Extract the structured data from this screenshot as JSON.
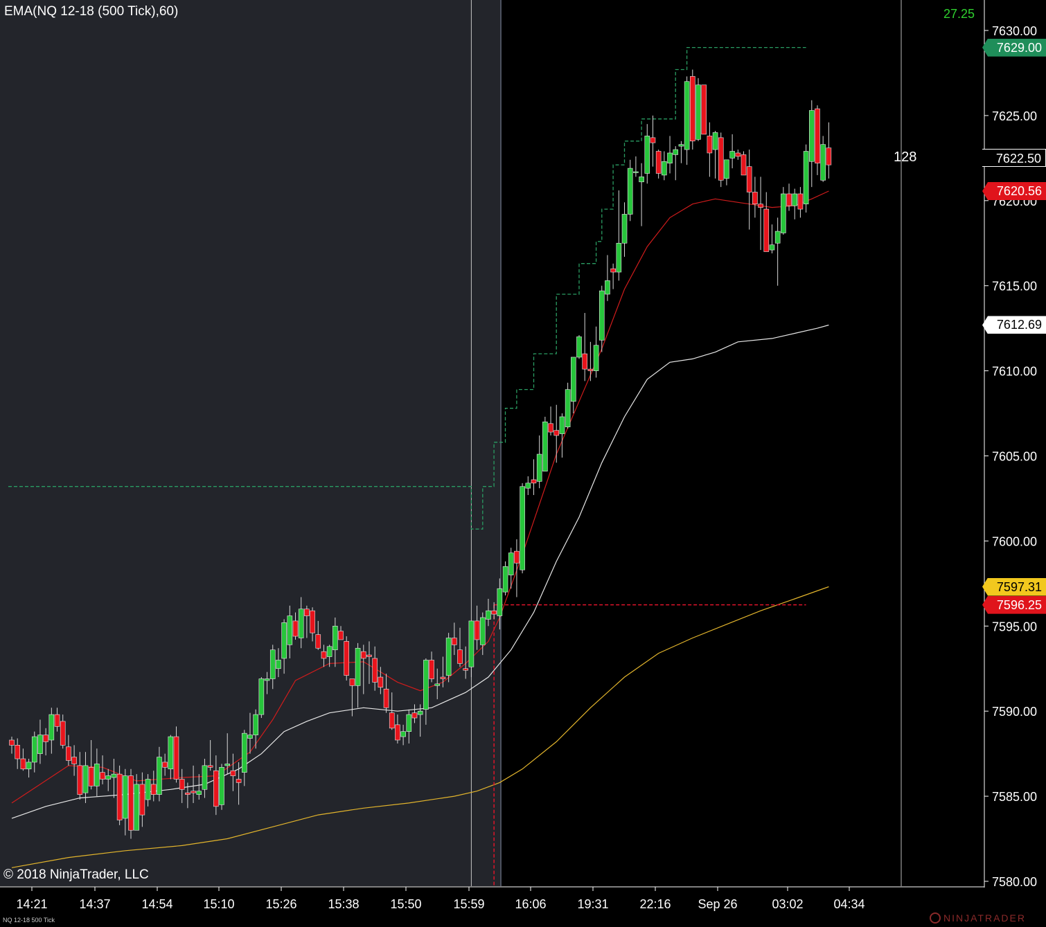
{
  "header": {
    "indicator_title": "EMA(NQ 12-18 (500 Tick),60)",
    "top_value": "27.25",
    "tick_count": "128",
    "copyright": "© 2018 NinjaTrader, LLC",
    "instrument_footer": "NQ 12-18 500 Tick",
    "logo_text": "NINJATRADER"
  },
  "colors": {
    "background_session": "#000000",
    "background_offsession": "#23252b",
    "up_candle": "#27c53b",
    "down_candle": "#e8141c",
    "ema_fast": "#d01c1c",
    "ema_mid": "#e8e8e8",
    "ema_slow": "#e3b52c",
    "high_level": "#2a9d63",
    "low_level": "#e0142a",
    "axis_text": "#ffffff"
  },
  "price_markers": [
    {
      "label": "7629.00",
      "price": 7629.0,
      "bg": "#1f8e5a",
      "fg": "#ffffff"
    },
    {
      "label": "7622.50",
      "price": 7622.5,
      "bg": "#000000",
      "fg": "#ffffff"
    },
    {
      "label": "7620.56",
      "price": 7620.56,
      "bg": "#e0141c",
      "fg": "#ffffff"
    },
    {
      "label": "7612.69",
      "price": 7612.69,
      "bg": "#ffffff",
      "fg": "#000000"
    },
    {
      "label": "7597.31",
      "price": 7597.31,
      "bg": "#f2c81e",
      "fg": "#000000"
    },
    {
      "label": "7596.25",
      "price": 7596.25,
      "bg": "#e0141c",
      "fg": "#ffffff"
    }
  ],
  "chart_data": {
    "type": "candlestick",
    "ylim": [
      7579.9,
      7630.3
    ],
    "y_ticks": [
      "7630.00",
      "7625.00",
      "7620.00",
      "7615.00",
      "7610.00",
      "7605.00",
      "7600.00",
      "7595.00",
      "7590.00",
      "7585.00",
      "7580.00"
    ],
    "x_labels": [
      "14:21",
      "14:37",
      "14:54",
      "15:10",
      "15:26",
      "15:38",
      "15:50",
      "15:59",
      "16:06",
      "19:31",
      "22:16",
      "Sep 26",
      "03:02",
      "04:34"
    ],
    "offsession_bar_range": [
      0,
      73
    ],
    "session_line_bar": 81,
    "candles": [
      [
        7588.3,
        7588.5,
        7587.5,
        7588.0
      ],
      [
        7588.0,
        7588.4,
        7586.6,
        7587.2
      ],
      [
        7587.2,
        7587.8,
        7586.5,
        7586.6
      ],
      [
        7586.6,
        7587.2,
        7586.1,
        7587.0
      ],
      [
        7587.0,
        7588.8,
        7586.4,
        7588.5
      ],
      [
        7587.5,
        7589.5,
        7586.9,
        7588.6
      ],
      [
        7588.6,
        7589.0,
        7587.4,
        7588.2
      ],
      [
        7588.3,
        7590.2,
        7587.5,
        7589.8
      ],
      [
        7589.8,
        7590.2,
        7588.8,
        7589.1
      ],
      [
        7589.4,
        7589.8,
        7587.8,
        7588.0
      ],
      [
        7587.9,
        7588.6,
        7586.8,
        7587.1
      ],
      [
        7587.3,
        7588.0,
        7586.2,
        7586.9
      ],
      [
        7586.8,
        7587.6,
        7584.8,
        7585.1
      ],
      [
        7585.2,
        7587.6,
        7584.6,
        7586.8
      ],
      [
        7586.7,
        7588.3,
        7585.4,
        7585.6
      ],
      [
        7585.6,
        7587.8,
        7585.0,
        7586.9
      ],
      [
        7586.4,
        7587.4,
        7585.7,
        7586.0
      ],
      [
        7586.0,
        7586.6,
        7585.3,
        7586.2
      ],
      [
        7586.1,
        7587.2,
        7584.9,
        7586.3
      ],
      [
        7586.3,
        7586.8,
        7583.3,
        7583.6
      ],
      [
        7583.7,
        7586.6,
        7582.7,
        7586.2
      ],
      [
        7586.2,
        7586.6,
        7582.5,
        7583.0
      ],
      [
        7583.0,
        7586.3,
        7583.0,
        7585.7
      ],
      [
        7585.7,
        7586.4,
        7583.2,
        7583.9
      ],
      [
        7584.8,
        7586.3,
        7584.4,
        7586.0
      ],
      [
        7585.7,
        7586.5,
        7584.7,
        7585.1
      ],
      [
        7585.1,
        7587.9,
        7584.7,
        7587.3
      ],
      [
        7587.0,
        7587.5,
        7586.2,
        7586.7
      ],
      [
        7586.6,
        7588.6,
        7586.0,
        7588.5
      ],
      [
        7588.5,
        7589.1,
        7585.8,
        7586.0
      ],
      [
        7586.0,
        7586.6,
        7584.6,
        7585.4
      ],
      [
        7585.2,
        7585.8,
        7584.3,
        7585.1
      ],
      [
        7585.3,
        7586.8,
        7584.6,
        7585.2
      ],
      [
        7585.1,
        7586.3,
        7584.8,
        7585.3
      ],
      [
        7585.4,
        7587.2,
        7584.9,
        7586.8
      ],
      [
        7586.8,
        7588.3,
        7586.5,
        7586.7
      ],
      [
        7586.5,
        7587.4,
        7583.9,
        7584.4
      ],
      [
        7584.5,
        7586.9,
        7584.2,
        7586.7
      ],
      [
        7586.8,
        7588.7,
        7586.3,
        7586.9
      ],
      [
        7586.5,
        7587.5,
        7585.3,
        7586.2
      ],
      [
        7586.0,
        7587.0,
        7584.5,
        7585.8
      ],
      [
        7586.4,
        7588.9,
        7585.6,
        7588.7
      ],
      [
        7588.4,
        7589.9,
        7587.5,
        7588.6
      ],
      [
        7588.6,
        7590.1,
        7587.8,
        7589.8
      ],
      [
        7589.8,
        7592.0,
        7589.6,
        7591.9
      ],
      [
        7591.8,
        7592.3,
        7591.0,
        7591.9
      ],
      [
        7591.9,
        7593.9,
        7591.3,
        7593.6
      ],
      [
        7592.5,
        7593.7,
        7592.0,
        7593.0
      ],
      [
        7593.1,
        7595.4,
        7592.2,
        7595.2
      ],
      [
        7593.9,
        7596.2,
        7593.1,
        7595.6
      ],
      [
        7595.3,
        7595.8,
        7594.2,
        7594.4
      ],
      [
        7594.3,
        7596.7,
        7593.7,
        7596.0
      ],
      [
        7596.0,
        7596.2,
        7594.3,
        7595.6
      ],
      [
        7595.9,
        7596.1,
        7594.1,
        7594.6
      ],
      [
        7594.5,
        7595.3,
        7593.6,
        7593.7
      ],
      [
        7593.5,
        7593.9,
        7592.6,
        7593.1
      ],
      [
        7593.2,
        7593.9,
        7592.6,
        7593.8
      ],
      [
        7593.6,
        7595.5,
        7592.6,
        7595.0
      ],
      [
        7594.7,
        7595.0,
        7594.3,
        7594.2
      ],
      [
        7594.1,
        7594.4,
        7591.8,
        7592.1
      ],
      [
        7591.9,
        7591.9,
        7589.7,
        7591.5
      ],
      [
        7591.5,
        7594.0,
        7590.2,
        7593.7
      ],
      [
        7593.5,
        7593.9,
        7591.0,
        7593.1
      ],
      [
        7593.3,
        7594.1,
        7591.6,
        7593.2
      ],
      [
        7593.1,
        7593.8,
        7591.2,
        7591.7
      ],
      [
        7592.0,
        7592.6,
        7591.0,
        7591.4
      ],
      [
        7591.3,
        7592.2,
        7589.9,
        7590.2
      ],
      [
        7589.9,
        7591.1,
        7588.9,
        7589.0
      ],
      [
        7589.2,
        7589.8,
        7588.1,
        7588.3
      ],
      [
        7588.5,
        7589.2,
        7588.0,
        7588.8
      ],
      [
        7588.8,
        7590.1,
        7588.1,
        7589.8
      ],
      [
        7589.9,
        7590.4,
        7589.3,
        7589.6
      ],
      [
        7589.8,
        7590.4,
        7588.5,
        7590.0
      ],
      [
        7590.1,
        7593.1,
        7589.2,
        7593.0
      ],
      [
        7593.0,
        7593.5,
        7591.7,
        7591.9
      ],
      [
        7591.5,
        7592.5,
        7590.7,
        7591.6
      ],
      [
        7592.0,
        7593.2,
        7591.4,
        7591.9
      ],
      [
        7592.1,
        7594.6,
        7591.7,
        7594.3
      ],
      [
        7594.3,
        7595.2,
        7593.3,
        7593.9
      ],
      [
        7593.6,
        7594.9,
        7592.6,
        7592.8
      ],
      [
        7592.5,
        7593.8,
        7591.9,
        7592.4
      ],
      [
        7592.6,
        7595.3,
        7592.0,
        7595.3
      ],
      [
        7595.3,
        7596.2,
        7593.6,
        7594.2
      ],
      [
        7593.9,
        7595.8,
        7593.3,
        7595.5
      ],
      [
        7595.4,
        7596.6,
        7595.0,
        7595.9
      ],
      [
        7595.9,
        7596.4,
        7595.4,
        7595.7
      ],
      [
        7595.6,
        7597.8,
        7594.8,
        7597.2
      ],
      [
        7597.0,
        7598.8,
        7596.8,
        7598.5
      ],
      [
        7598.0,
        7599.6,
        7597.2,
        7599.3
      ],
      [
        7599.4,
        7600.1,
        7596.7,
        7598.7
      ],
      [
        7598.3,
        7603.4,
        7598.1,
        7603.2
      ],
      [
        7603.1,
        7603.8,
        7602.7,
        7603.4
      ],
      [
        7603.6,
        7604.8,
        7602.7,
        7603.4
      ],
      [
        7603.5,
        7606.2,
        7603.1,
        7605.1
      ],
      [
        7604.1,
        7607.3,
        7604.1,
        7607.0
      ],
      [
        7606.9,
        7607.9,
        7606.2,
        7606.4
      ],
      [
        7606.5,
        7608.0,
        7604.6,
        7606.2
      ],
      [
        7606.3,
        7607.5,
        7604.9,
        7607.3
      ],
      [
        7606.7,
        7609.3,
        7606.6,
        7608.9
      ],
      [
        7608.2,
        7610.8,
        7607.5,
        7610.8
      ],
      [
        7610.8,
        7612.1,
        7610.7,
        7612.0
      ],
      [
        7611.0,
        7613.4,
        7609.4,
        7610.1
      ],
      [
        7610.1,
        7611.7,
        7609.4,
        7610.0
      ],
      [
        7610.0,
        7612.6,
        7609.6,
        7611.5
      ],
      [
        7611.8,
        7615.0,
        7611.1,
        7614.7
      ],
      [
        7614.5,
        7616.8,
        7614.1,
        7615.3
      ],
      [
        7616.0,
        7616.3,
        7614.8,
        7615.8
      ],
      [
        7615.8,
        7620.6,
        7615.3,
        7617.5
      ],
      [
        7617.5,
        7619.9,
        7616.7,
        7619.2
      ],
      [
        7619.2,
        7622.4,
        7618.8,
        7621.9
      ],
      [
        7621.7,
        7622.6,
        7621.4,
        7621.7
      ],
      [
        7621.1,
        7622.2,
        7618.5,
        7621.4
      ],
      [
        7621.6,
        7624.5,
        7621.0,
        7623.8
      ],
      [
        7623.7,
        7625.0,
        7622.0,
        7623.4
      ],
      [
        7622.9,
        7623.0,
        7621.3,
        7621.6
      ],
      [
        7621.5,
        7622.9,
        7621.2,
        7622.3
      ],
      [
        7622.2,
        7623.8,
        7621.6,
        7622.8
      ],
      [
        7622.7,
        7623.2,
        7621.2,
        7623.0
      ],
      [
        7623.2,
        7623.5,
        7622.2,
        7623.3
      ],
      [
        7623.0,
        7627.3,
        7622.1,
        7627.0
      ],
      [
        7627.3,
        7627.7,
        7623.0,
        7623.5
      ],
      [
        7623.6,
        7627.2,
        7623.5,
        7626.8
      ],
      [
        7626.8,
        7626.8,
        7623.9,
        7623.9
      ],
      [
        7623.8,
        7624.6,
        7621.4,
        7622.8
      ],
      [
        7623.0,
        7624.1,
        7621.3,
        7624.0
      ],
      [
        7623.7,
        7624.0,
        7620.8,
        7621.2
      ],
      [
        7621.3,
        7622.4,
        7620.9,
        7622.4
      ],
      [
        7622.5,
        7623.9,
        7621.9,
        7622.9
      ],
      [
        7622.8,
        7623.0,
        7622.4,
        7622.6
      ],
      [
        7622.7,
        7622.9,
        7622.4,
        7621.5
      ],
      [
        7622.0,
        7623.0,
        7618.3,
        7620.5
      ],
      [
        7620.5,
        7621.4,
        7619.0,
        7619.8
      ],
      [
        7619.8,
        7621.4,
        7617.1,
        7619.6
      ],
      [
        7619.5,
        7620.5,
        7617.0,
        7617.0
      ],
      [
        7617.1,
        7618.6,
        7616.9,
        7617.4
      ],
      [
        7617.5,
        7619.0,
        7615.0,
        7618.2
      ],
      [
        7618.1,
        7620.8,
        7618.0,
        7620.4
      ],
      [
        7620.4,
        7621.0,
        7619.4,
        7619.7
      ],
      [
        7619.7,
        7620.7,
        7618.9,
        7620.4
      ],
      [
        7620.4,
        7620.8,
        7619.0,
        7619.5
      ],
      [
        7619.8,
        7623.3,
        7619.3,
        7622.9
      ],
      [
        7622.3,
        7625.9,
        7620.8,
        7625.3
      ],
      [
        7625.4,
        7625.6,
        7621.5,
        7622.2
      ],
      [
        7621.2,
        7623.8,
        7621.1,
        7623.3
      ],
      [
        7623.1,
        7624.6,
        7621.3,
        7622.1
      ]
    ],
    "ema_fast": [
      [
        0,
        7584.6
      ],
      [
        10,
        7586.8
      ],
      [
        16,
        7586.7
      ],
      [
        22,
        7585.9
      ],
      [
        30,
        7586.1
      ],
      [
        36,
        7586.2
      ],
      [
        42,
        7587.6
      ],
      [
        46,
        7589.5
      ],
      [
        50,
        7591.8
      ],
      [
        56,
        7592.8
      ],
      [
        62,
        7592.9
      ],
      [
        68,
        7591.7
      ],
      [
        72,
        7591.2
      ],
      [
        76,
        7591.7
      ],
      [
        80,
        7592.8
      ],
      [
        84,
        7594.1
      ],
      [
        86,
        7595.5
      ],
      [
        90,
        7599.2
      ],
      [
        96,
        7605.1
      ],
      [
        100,
        7608.2
      ],
      [
        104,
        7611.3
      ],
      [
        108,
        7614.8
      ],
      [
        112,
        7617.3
      ],
      [
        116,
        7619.0
      ],
      [
        120,
        7619.8
      ],
      [
        124,
        7620.1
      ],
      [
        128,
        7619.9
      ],
      [
        130,
        7619.8
      ],
      [
        134,
        7619.6
      ],
      [
        138,
        7619.7
      ],
      [
        141,
        7620.1
      ],
      [
        144,
        7620.56
      ]
    ],
    "ema_mid": [
      [
        0,
        7583.7
      ],
      [
        6,
        7584.4
      ],
      [
        12,
        7584.9
      ],
      [
        20,
        7585.1
      ],
      [
        28,
        7585.4
      ],
      [
        34,
        7585.7
      ],
      [
        40,
        7586.6
      ],
      [
        44,
        7587.5
      ],
      [
        48,
        7588.8
      ],
      [
        52,
        7589.4
      ],
      [
        56,
        7589.9
      ],
      [
        62,
        7590.2
      ],
      [
        68,
        7590.0
      ],
      [
        74,
        7590.2
      ],
      [
        80,
        7591.1
      ],
      [
        84,
        7592.0
      ],
      [
        88,
        7593.6
      ],
      [
        92,
        7595.8
      ],
      [
        96,
        7598.8
      ],
      [
        100,
        7601.4
      ],
      [
        104,
        7604.6
      ],
      [
        108,
        7607.3
      ],
      [
        112,
        7609.5
      ],
      [
        116,
        7610.5
      ],
      [
        120,
        7610.7
      ],
      [
        124,
        7611.1
      ],
      [
        128,
        7611.7
      ],
      [
        134,
        7611.9
      ],
      [
        138,
        7612.2
      ],
      [
        142,
        7612.5
      ],
      [
        144,
        7612.69
      ]
    ],
    "ema_slow": [
      [
        0,
        7580.8
      ],
      [
        10,
        7581.4
      ],
      [
        20,
        7581.8
      ],
      [
        30,
        7582.1
      ],
      [
        38,
        7582.5
      ],
      [
        46,
        7583.2
      ],
      [
        54,
        7583.9
      ],
      [
        62,
        7584.3
      ],
      [
        70,
        7584.6
      ],
      [
        78,
        7585.0
      ],
      [
        82,
        7585.3
      ],
      [
        86,
        7585.8
      ],
      [
        90,
        7586.6
      ],
      [
        96,
        7588.2
      ],
      [
        102,
        7590.2
      ],
      [
        108,
        7592.0
      ],
      [
        114,
        7593.4
      ],
      [
        120,
        7594.3
      ],
      [
        126,
        7595.1
      ],
      [
        132,
        7595.9
      ],
      [
        138,
        7596.6
      ],
      [
        144,
        7597.31
      ]
    ],
    "levels": {
      "high": {
        "steps": [
          [
            0,
            7603.2
          ],
          [
            81,
            7603.2
          ],
          [
            81,
            7600.7
          ],
          [
            83,
            7600.7
          ],
          [
            83,
            7603.2
          ],
          [
            85,
            7603.2
          ],
          [
            85,
            7605.8
          ],
          [
            87,
            7605.8
          ],
          [
            87,
            7607.8
          ],
          [
            89,
            7607.8
          ],
          [
            89,
            7608.9
          ],
          [
            92,
            7608.9
          ],
          [
            92,
            7611.0
          ],
          [
            96,
            7611.0
          ],
          [
            96,
            7614.5
          ],
          [
            100,
            7614.5
          ],
          [
            100,
            7616.3
          ],
          [
            103,
            7616.3
          ],
          [
            103,
            7617.6
          ],
          [
            104,
            7617.6
          ],
          [
            104,
            7619.5
          ],
          [
            106,
            7619.5
          ],
          [
            106,
            7622.1
          ],
          [
            108,
            7622.1
          ],
          [
            108,
            7623.5
          ],
          [
            111,
            7623.5
          ],
          [
            111,
            7624.8
          ],
          [
            117,
            7624.8
          ],
          [
            117,
            7627.7
          ],
          [
            119,
            7627.7
          ],
          [
            119,
            7629.0
          ],
          [
            140,
            7629.0
          ]
        ]
      },
      "low": {
        "price": 7596.25,
        "start_bar": 85,
        "end_bar": 140,
        "vertical_bar": 85
      }
    }
  }
}
